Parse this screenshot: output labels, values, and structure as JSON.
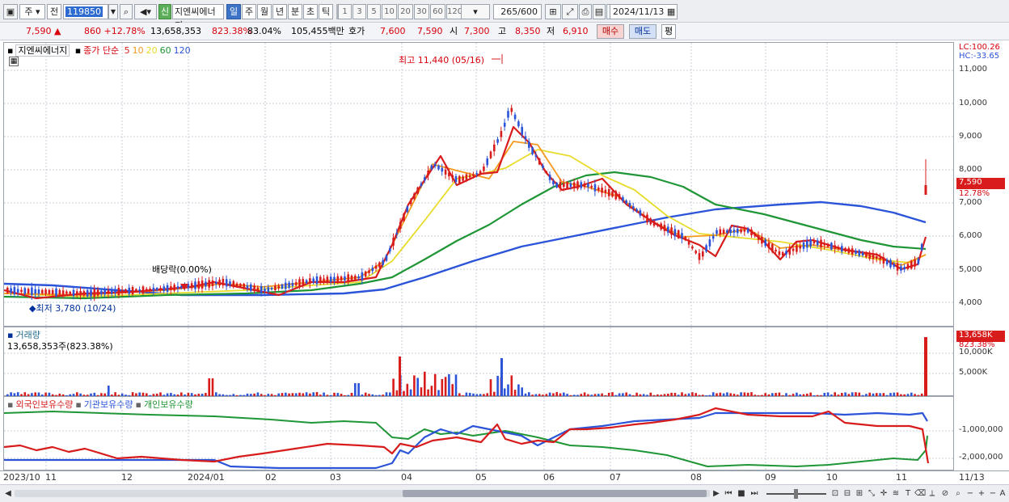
{
  "toolbar": {
    "period_label": "주",
    "jeon_label": "전",
    "code": "119850",
    "shin_label": "신",
    "stock_name": "지엔씨에너지",
    "periods": [
      "일",
      "주",
      "월",
      "년",
      "분",
      "초",
      "틱"
    ],
    "intervals": [
      "1",
      "3",
      "5",
      "10",
      "20",
      "30",
      "60",
      "120"
    ],
    "count": "265",
    "count_total": "/600",
    "date": "2024/11/13"
  },
  "quote": {
    "price": "7,590",
    "arrow": "▲",
    "change": "860",
    "change_pct": "+12.78%",
    "volume": "13,658,353",
    "volume_ratio": "823.38%",
    "turnover": "83.04%",
    "amount": "105,455백만",
    "hoga_label": "호가",
    "ask": "7,600",
    "bid": "7,590",
    "open_label": "시",
    "open": "7,300",
    "high_label": "고",
    "high": "8,350",
    "low_label": "저",
    "low": "6,910",
    "buy_label": "매수",
    "sell_label": "매도",
    "eval_label": "평"
  },
  "price_panel": {
    "name": "지엔씨에너지",
    "ma_label": "종가 단순",
    "ma_periods": [
      "5",
      "10",
      "20",
      "60",
      "120"
    ],
    "ma_colors": [
      "#d81c1c",
      "#f39a1e",
      "#e8dc2a",
      "#1f9636",
      "#2b54d8"
    ],
    "lc": "LC:100.26",
    "hc": "HC:-33.65",
    "high_note": "최고 11,440 (05/16)",
    "low_note": "최저 3,780 (10/24)",
    "dividend_note": "배당락(0.00%)",
    "last_price": "7,590",
    "last_pct": "12.78%",
    "y_ticks": [
      "11,000",
      "10,000",
      "9,000",
      "8,000",
      "7,000",
      "6,000",
      "5,000",
      "4,000"
    ]
  },
  "volume_panel": {
    "title": "거래량",
    "value": "13,658,353주(823.38%)",
    "last": "13,658K",
    "last_pct": "823.38%",
    "y_ticks": [
      "10,000K",
      "5,000K"
    ]
  },
  "holdings_panel": {
    "series": [
      "외국인보유수량",
      "기관보유수량",
      "개인보유수량"
    ],
    "colors": [
      "#d81c1c",
      "#2b54d8",
      "#1f9636"
    ],
    "y_ticks": [
      "-1,000,000",
      "-2,000,000"
    ]
  },
  "x_axis": [
    "2023/10",
    "11",
    "12",
    "2024/01",
    "02",
    "03",
    "04",
    "05",
    "06",
    "07",
    "08",
    "09",
    "10",
    "11",
    "11/13"
  ]
}
